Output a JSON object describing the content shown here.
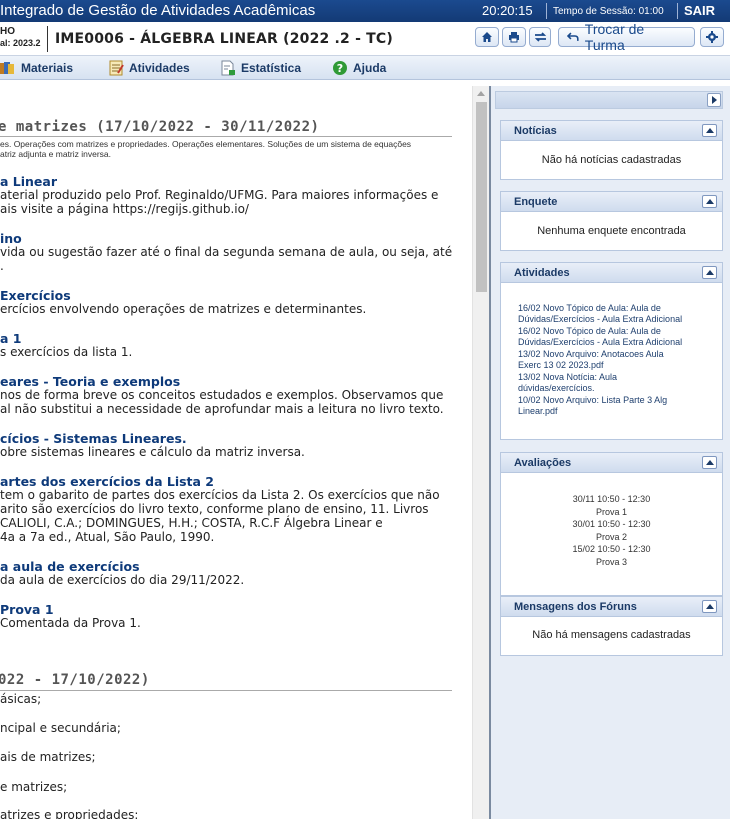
{
  "topbar": {
    "system_title": "Integrado de Gestão de Atividades Acadêmicas",
    "clock": "20:20:15",
    "session_label": "Tempo de Sessão: 01:00",
    "logout": "SAIR"
  },
  "header": {
    "user_line1": "HO",
    "user_line2": "al: 2023.2",
    "course_title": "IME0006 - ÁLGEBRA LINEAR (2022 .2 - TC)",
    "change_class_label": "Trocar de Turma"
  },
  "menu": [
    {
      "label": "Materiais",
      "icon": "books-icon"
    },
    {
      "label": "Atividades",
      "icon": "notepad-icon"
    },
    {
      "label": "Estatística",
      "icon": "document-chart-icon"
    },
    {
      "label": "Ajuda",
      "icon": "help-icon"
    }
  ],
  "main": {
    "topic1": {
      "title": "e matrizes (17/10/2022 - 30/11/2022)",
      "desc_line1": "es. Operações com matrizes e propriedades. Operações elementares. Soluções de um sistema de equações",
      "desc_line2": "atriz adjunta e matriz inversa.",
      "items": [
        {
          "title": "a Linear",
          "text": "aterial produzido pelo Prof. Reginaldo/UFMG. Para maiores informações e\nais visite a página https://regijs.github.io/"
        },
        {
          "title": "ino",
          "text": "vida ou sugestão fazer até o final da segunda semana de aula, ou seja, até\n."
        },
        {
          "title": "Exercícios",
          "text": "ercícios envolvendo operações de matrizes e determinantes."
        },
        {
          "title": "a 1",
          "text": "s exercícios da lista 1."
        },
        {
          "title": "eares - Teoria e exemplos",
          "text": "nos de forma breve os conceitos estudados e exemplos. Observamos que\nal não substitui a necessidade de aprofundar mais a leitura no livro texto."
        },
        {
          "title": "cícios - Sistemas Lineares.",
          "text": "obre sistemas lineares e cálculo da matriz inversa."
        },
        {
          "title": "artes dos exercícios da Lista 2",
          "text": "tem o gabarito de partes dos exercícios da Lista 2. Os exercícios que não\narito são exercícios do livro texto, conforme plano de ensino, 11. Livros\nCALIOLI, C.A.; DOMINGUES, H.H.; COSTA, R.C.F Álgebra Linear e\n4a a 7a ed., Atual, São Paulo, 1990."
        },
        {
          "title": "a aula de exercícios",
          "text": "da aula de exercícios do dia 29/11/2022."
        },
        {
          "title": " Prova 1",
          "text": "Comentada da Prova 1."
        }
      ]
    },
    "topic2": {
      "title": "022 - 17/10/2022)",
      "lines": [
        "ásicas;",
        "ncipal e secundária;",
        "ais de matrizes;",
        "e matrizes;",
        "atrizes e propriedades;"
      ]
    }
  },
  "sidebar": {
    "noticias": {
      "title": "Notícias",
      "message": "Não há notícias cadastradas"
    },
    "enquete": {
      "title": "Enquete",
      "message": "Nenhuma enquete encontrada"
    },
    "atividades": {
      "title": "Atividades",
      "items": [
        {
          "line1": "16/02 Novo Tópico de Aula: Aula de",
          "line2": "Dúvidas/Exercícios - Aula Extra Adicional"
        },
        {
          "line1": "16/02 Novo Tópico de Aula: Aula de",
          "line2": "Dúvidas/Exercícios - Aula Extra Adicional"
        },
        {
          "line1": "13/02 Novo Arquivo: Anotacoes Aula",
          "line2": "Exerc 13 02 2023.pdf"
        },
        {
          "line1": "13/02 Nova Notícia: Aula",
          "line2": "dúvidas/exercícios."
        },
        {
          "line1": "10/02 Novo Arquivo: Lista Parte 3 Alg",
          "line2": "Linear.pdf"
        }
      ]
    },
    "avaliacoes": {
      "title": "Avaliações",
      "items": [
        {
          "when": "30/11 10:50 - 12:30",
          "name": "Prova 1"
        },
        {
          "when": "30/01 10:50 - 12:30",
          "name": "Prova 2"
        },
        {
          "when": "15/02 10:50 - 12:30",
          "name": "Prova 3"
        }
      ]
    },
    "foruns": {
      "title": "Mensagens dos Fóruns",
      "message": "Não há mensagens cadastradas"
    }
  },
  "colors": {
    "brand": "#133a75",
    "link": "#0e3a7a",
    "panel_border": "#b7c7df"
  }
}
